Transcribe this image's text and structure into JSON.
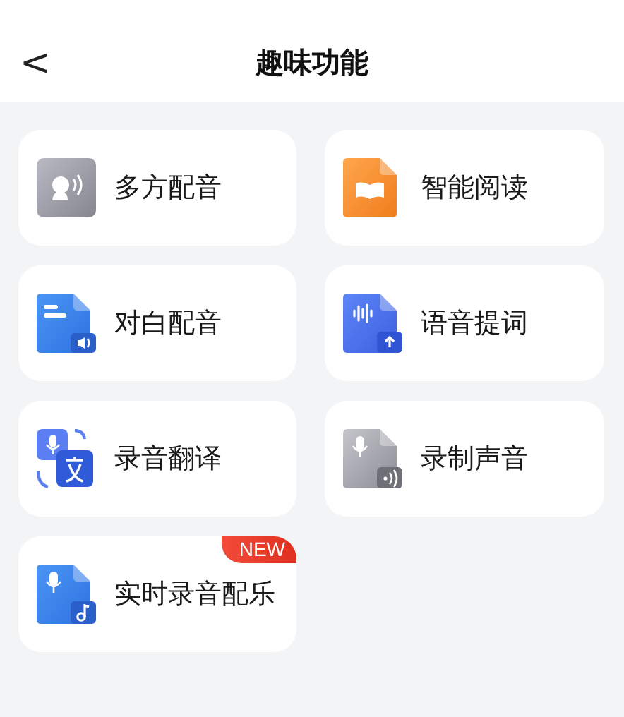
{
  "header": {
    "back": "<",
    "title": "趣味功能"
  },
  "features": [
    {
      "label": "多方配音",
      "kind": "voice"
    },
    {
      "label": "智能阅读",
      "kind": "book"
    },
    {
      "label": "对白配音",
      "kind": "dialogue"
    },
    {
      "label": "语音提词",
      "kind": "prompter"
    },
    {
      "label": "录音翻译",
      "kind": "translate"
    },
    {
      "label": "录制声音",
      "kind": "record"
    },
    {
      "badge": "NEW",
      "label": "实时录音配乐",
      "kind": "music"
    }
  ]
}
